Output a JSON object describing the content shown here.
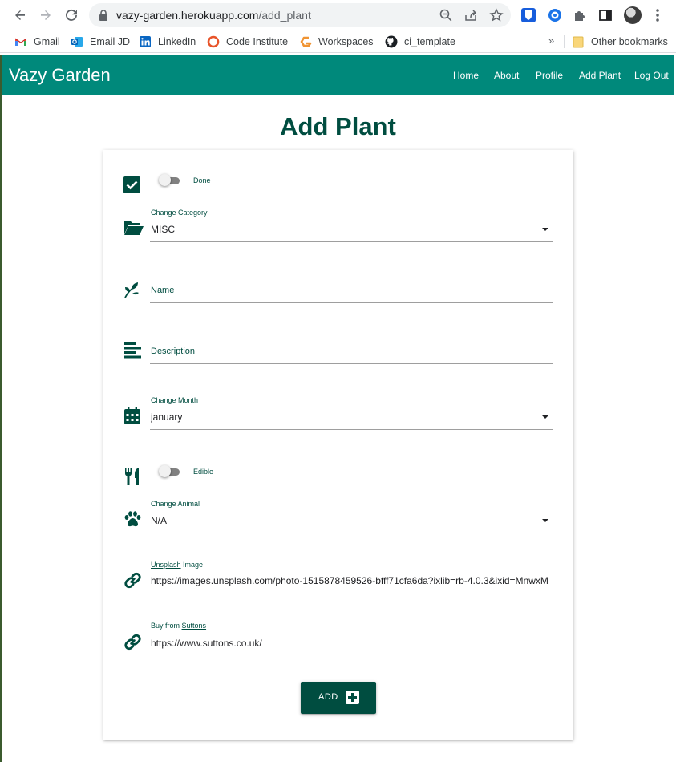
{
  "browser": {
    "url_host": "vazy-garden.herokuapp.com",
    "url_path": "/add_plant",
    "bookmarks": [
      {
        "label": "Gmail",
        "icon": "gmail-icon"
      },
      {
        "label": "Email JD",
        "icon": "outlook-icon"
      },
      {
        "label": "LinkedIn",
        "icon": "linkedin-icon"
      },
      {
        "label": "Code Institute",
        "icon": "code-institute-icon"
      },
      {
        "label": "Workspaces",
        "icon": "workspaces-icon"
      },
      {
        "label": "ci_template",
        "icon": "github-icon"
      }
    ],
    "more_label": "»",
    "other_bookmarks": "Other bookmarks"
  },
  "navbar": {
    "brand": "Vazy Garden",
    "links": [
      "Home",
      "About",
      "Profile",
      "Add Plant",
      "Log Out"
    ],
    "color": "#00897b"
  },
  "page": {
    "title": "Add Plant",
    "accent": "#004d40"
  },
  "form": {
    "done_switch": {
      "label": "Done",
      "checked": false,
      "icon": "checkbox-checked-icon"
    },
    "category": {
      "label": "Change Category",
      "value": "MISC",
      "icon": "folder-open-icon"
    },
    "name": {
      "placeholder": "Name",
      "value": "",
      "icon": "leaf-icon"
    },
    "description": {
      "placeholder": "Description",
      "value": "",
      "icon": "align-left-icon"
    },
    "month": {
      "label": "Change Month",
      "value": "january",
      "icon": "calendar-icon"
    },
    "edible_switch": {
      "label": "Edible",
      "checked": false,
      "icon": "utensils-icon"
    },
    "animal": {
      "label": "Change Animal",
      "value": "N/A",
      "icon": "paw-icon"
    },
    "image": {
      "label_link": "Unsplash",
      "label_rest": " Image",
      "value": "https://images.unsplash.com/photo-1515878459526-bfff71cfa6da?ixlib=rb-4.0.3&ixid=MnwxM",
      "icon": "link-icon"
    },
    "buy": {
      "label_prefix": "Buy from ",
      "label_link": "Suttons",
      "value": "https://www.suttons.co.uk/",
      "icon": "link-icon"
    },
    "submit": {
      "label": "ADD",
      "icon": "plus-square-icon"
    }
  }
}
